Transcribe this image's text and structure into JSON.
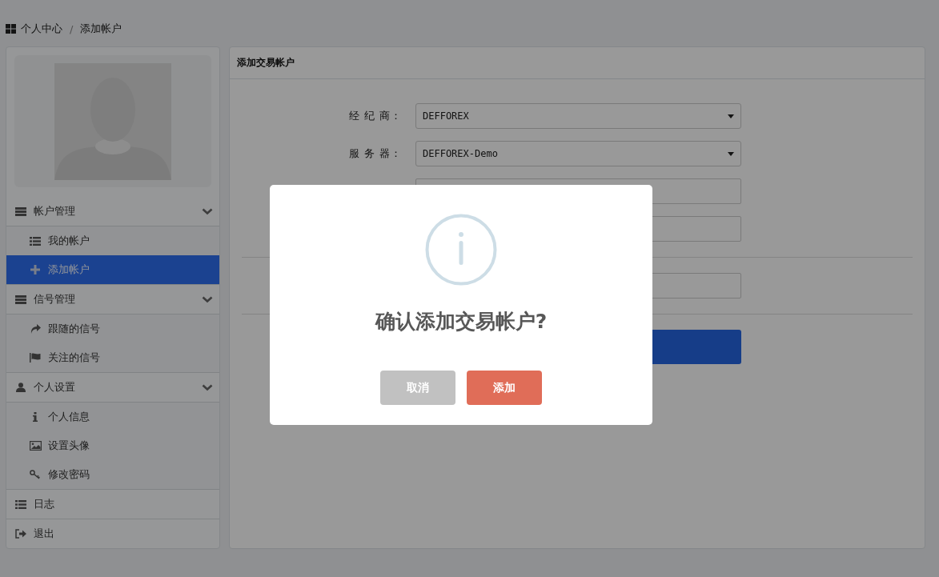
{
  "breadcrumb": {
    "separator": "/",
    "items": [
      {
        "label": "个人中心"
      },
      {
        "label": "添加帐户"
      }
    ]
  },
  "sidebar": {
    "groups": [
      {
        "label": "帐户管理",
        "expanded": true,
        "children": [
          {
            "label": "我的帐户",
            "selected": false
          },
          {
            "label": "添加帐户",
            "selected": true
          }
        ]
      },
      {
        "label": "信号管理",
        "expanded": true,
        "children": [
          {
            "label": "跟随的信号",
            "selected": false
          },
          {
            "label": "关注的信号",
            "selected": false
          }
        ]
      },
      {
        "label": "个人设置",
        "expanded": true,
        "children": [
          {
            "label": "个人信息",
            "selected": false
          },
          {
            "label": "设置头像",
            "selected": false
          },
          {
            "label": "修改密码",
            "selected": false
          }
        ]
      },
      {
        "label": "日志"
      },
      {
        "label": "退出"
      }
    ]
  },
  "panel": {
    "title": "添加交易帐户",
    "rows": [
      {
        "kind": "select",
        "label": "经 纪 商：",
        "value": "DEFFOREX"
      },
      {
        "kind": "select",
        "label": "服 务 器：",
        "value": "DEFFOREX-Demo"
      },
      {
        "kind": "input"
      },
      {
        "kind": "input"
      },
      {
        "kind": "divider"
      },
      {
        "kind": "input"
      },
      {
        "kind": "divider"
      },
      {
        "kind": "button"
      }
    ]
  },
  "dialog": {
    "title": "确认添加交易帐户?",
    "buttons": [
      {
        "label": "取消",
        "kind": "cancel"
      },
      {
        "label": "添加",
        "kind": "confirm"
      }
    ]
  }
}
